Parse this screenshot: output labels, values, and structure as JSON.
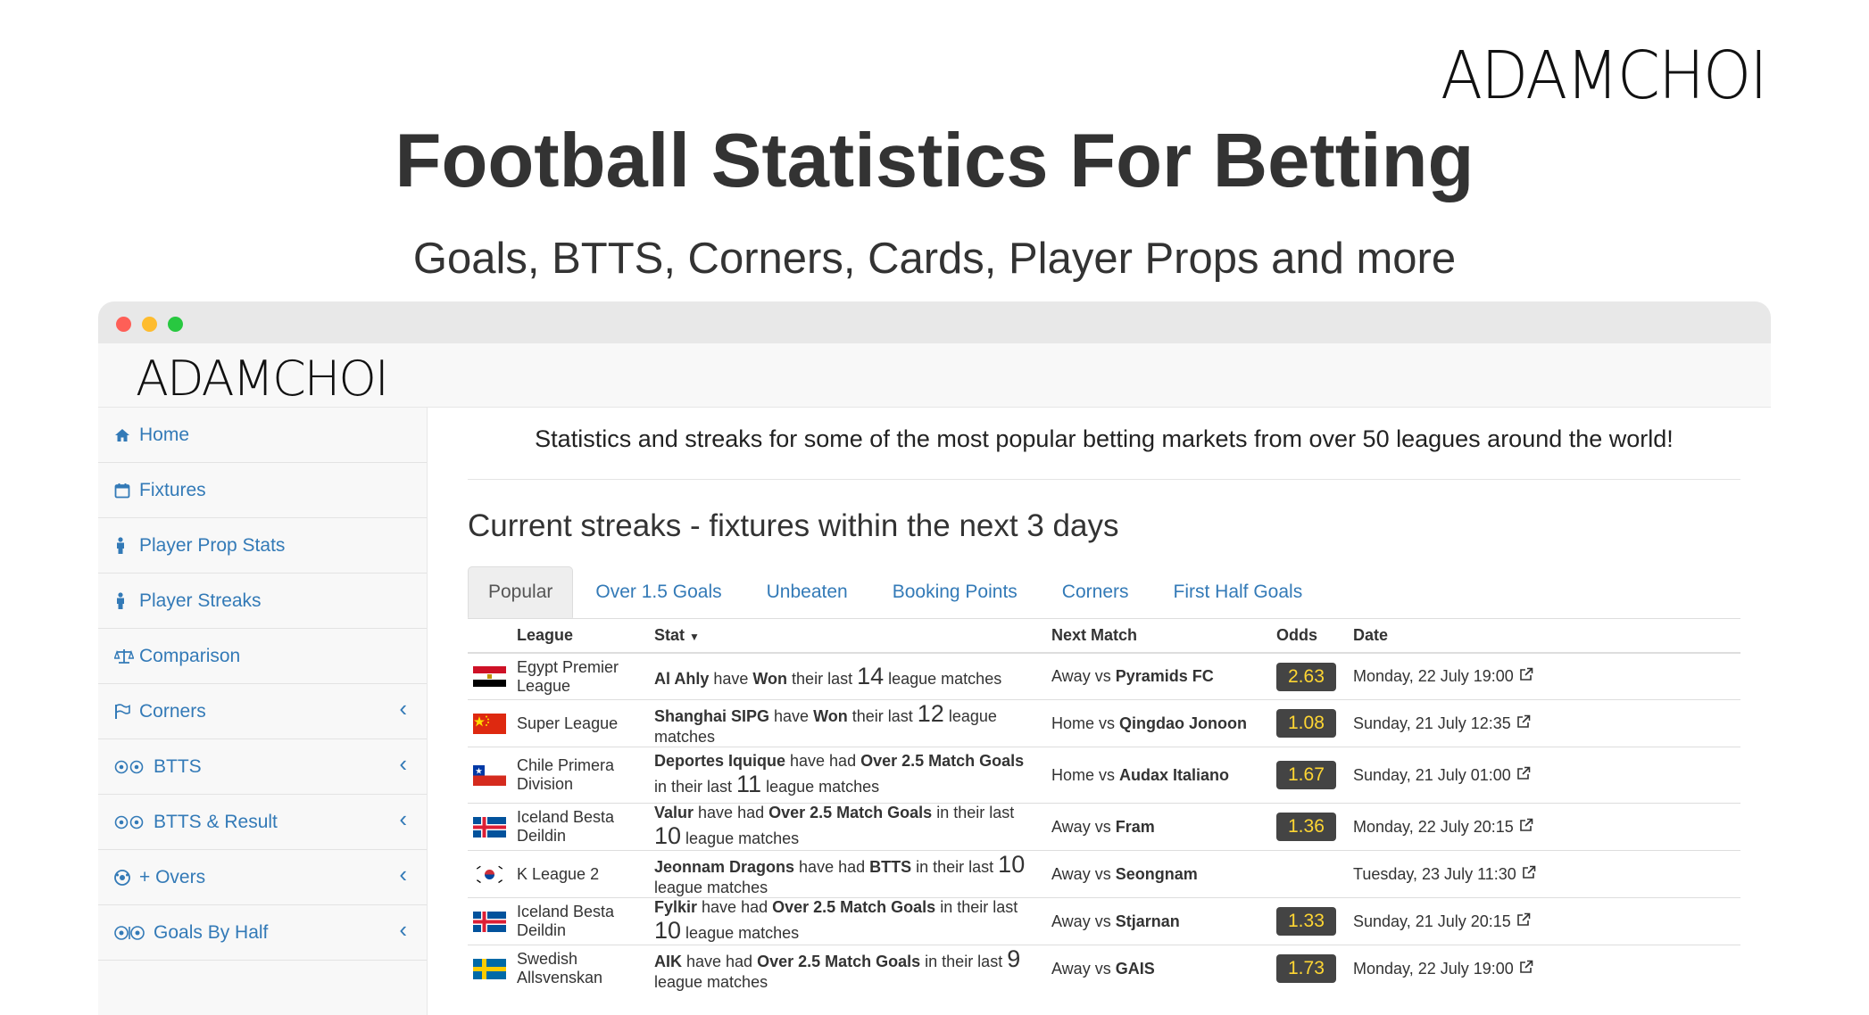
{
  "brand": "ADAMCHOI",
  "hero": {
    "title": "Football Statistics For Betting",
    "subtitle": "Goals, BTTS, Corners, Cards, Player Props and more"
  },
  "window": {
    "logo": "ADAMCHOI"
  },
  "sidebar": {
    "items": [
      {
        "label": "Home",
        "icon": "home-icon",
        "has_submenu": false
      },
      {
        "label": "Fixtures",
        "icon": "calendar-icon",
        "has_submenu": false
      },
      {
        "label": "Player Prop Stats",
        "icon": "person-icon",
        "has_submenu": false
      },
      {
        "label": "Player Streaks",
        "icon": "person-icon",
        "has_submenu": false
      },
      {
        "label": "Comparison",
        "icon": "balance-scale-icon",
        "has_submenu": false
      },
      {
        "label": "Corners",
        "icon": "flag-icon",
        "has_submenu": true
      },
      {
        "label": "BTTS",
        "icon": "two-balls-icon",
        "has_submenu": true
      },
      {
        "label": "BTTS & Result",
        "icon": "two-balls-icon",
        "has_submenu": true
      },
      {
        "label": "+ Overs",
        "icon": "ball-icon",
        "has_submenu": true
      },
      {
        "label": "Goals By Half",
        "icon": "ball-half-icon",
        "has_submenu": true
      }
    ]
  },
  "main": {
    "intro": "Statistics and streaks for some of the most popular betting markets from over 50 leagues around the world!",
    "streak_title": "Current streaks - fixtures within the next 3 days",
    "tabs": [
      "Popular",
      "Over 1.5 Goals",
      "Unbeaten",
      "Booking Points",
      "Corners",
      "First Half Goals"
    ],
    "active_tab": "Popular",
    "columns": [
      "League",
      "Stat",
      "Next Match",
      "Odds",
      "Date"
    ],
    "sort_icon": "caret-down-icon",
    "rows": [
      {
        "flag": "egypt",
        "league": "Egypt Premier League",
        "stat": [
          [
            "b",
            "Al Ahly"
          ],
          [
            "t",
            " have "
          ],
          [
            "b",
            "Won"
          ],
          [
            "t",
            " their last "
          ],
          [
            "n",
            "14"
          ],
          [
            "t",
            " league matches"
          ]
        ],
        "venue": "Away vs ",
        "opponent": "Pyramids FC",
        "odds": "2.63",
        "date": "Monday, 22 July 19:00"
      },
      {
        "flag": "china",
        "league": "Super League",
        "stat": [
          [
            "b",
            "Shanghai SIPG"
          ],
          [
            "t",
            " have "
          ],
          [
            "b",
            "Won"
          ],
          [
            "t",
            " their last "
          ],
          [
            "n",
            "12"
          ],
          [
            "t",
            " league matches"
          ]
        ],
        "venue": "Home vs ",
        "opponent": "Qingdao Jonoon",
        "odds": "1.08",
        "date": "Sunday, 21 July 12:35"
      },
      {
        "flag": "chile",
        "league": "Chile Primera Division",
        "stat": [
          [
            "b",
            "Deportes Iquique"
          ],
          [
            "t",
            " have had "
          ],
          [
            "b",
            "Over 2.5 Match Goals"
          ],
          [
            "t",
            " in their last "
          ],
          [
            "n",
            "11"
          ],
          [
            "t",
            " league matches"
          ]
        ],
        "venue": "Home vs ",
        "opponent": "Audax Italiano",
        "odds": "1.67",
        "date": "Sunday, 21 July 01:00"
      },
      {
        "flag": "iceland",
        "league": "Iceland Besta Deildin",
        "stat": [
          [
            "b",
            "Valur"
          ],
          [
            "t",
            " have had "
          ],
          [
            "b",
            "Over 2.5 Match Goals"
          ],
          [
            "t",
            " in their last "
          ],
          [
            "n",
            "10"
          ],
          [
            "t",
            " league matches"
          ]
        ],
        "venue": "Away vs ",
        "opponent": "Fram",
        "odds": "1.36",
        "date": "Monday, 22 July 20:15"
      },
      {
        "flag": "korea",
        "league": "K League 2",
        "stat": [
          [
            "b",
            "Jeonnam Dragons"
          ],
          [
            "t",
            " have had "
          ],
          [
            "b",
            "BTTS"
          ],
          [
            "t",
            " in their last "
          ],
          [
            "n",
            "10"
          ],
          [
            "t",
            " league matches"
          ]
        ],
        "venue": "Away vs ",
        "opponent": "Seongnam",
        "odds": "",
        "date": "Tuesday, 23 July 11:30"
      },
      {
        "flag": "iceland",
        "league": "Iceland Besta Deildin",
        "stat": [
          [
            "b",
            "Fylkir"
          ],
          [
            "t",
            " have had "
          ],
          [
            "b",
            "Over 2.5 Match Goals"
          ],
          [
            "t",
            " in their last "
          ],
          [
            "n",
            "10"
          ],
          [
            "t",
            " league matches"
          ]
        ],
        "venue": "Away vs ",
        "opponent": "Stjarnan",
        "odds": "1.33",
        "date": "Sunday, 21 July 20:15"
      },
      {
        "flag": "sweden",
        "league": "Swedish Allsvenskan",
        "stat": [
          [
            "b",
            "AIK"
          ],
          [
            "t",
            " have had "
          ],
          [
            "b",
            "Over 2.5 Match Goals"
          ],
          [
            "t",
            " in their last "
          ],
          [
            "n",
            "9"
          ],
          [
            "t",
            " league matches"
          ]
        ],
        "venue": "Away vs ",
        "opponent": "GAIS",
        "odds": "1.73",
        "date": "Monday, 22 July 19:00"
      }
    ]
  },
  "colors": {
    "link": "#337ab7",
    "odds_bg": "#444444",
    "odds_text": "#ffd633"
  }
}
